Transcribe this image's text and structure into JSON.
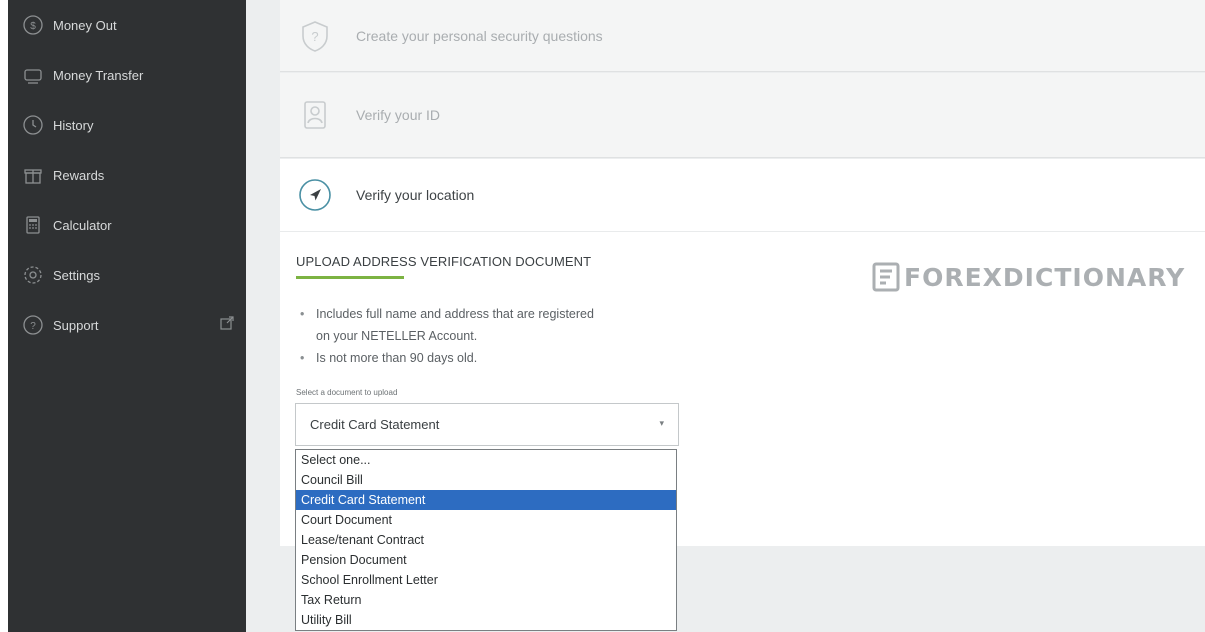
{
  "sidebar": {
    "items": [
      {
        "label": "Money Out",
        "icon": "money-out-icon"
      },
      {
        "label": "Money Transfer",
        "icon": "money-transfer-icon"
      },
      {
        "label": "History",
        "icon": "history-icon"
      },
      {
        "label": "Rewards",
        "icon": "rewards-icon"
      },
      {
        "label": "Calculator",
        "icon": "calculator-icon"
      },
      {
        "label": "Settings",
        "icon": "settings-icon"
      },
      {
        "label": "Support",
        "icon": "support-icon"
      }
    ]
  },
  "steps": [
    {
      "label": "Create your personal security questions",
      "icon": "shield-question-icon"
    },
    {
      "label": "Verify your ID",
      "icon": "id-card-icon"
    },
    {
      "label": "Verify your location",
      "icon": "location-arrow-icon"
    }
  ],
  "upload": {
    "title": "UPLOAD ADDRESS VERIFICATION DOCUMENT",
    "requirements": [
      "Includes full name and address that are registered",
      "on your NETELLER Account.",
      "Is not more than 90 days old."
    ],
    "select_label": "Select a document to upload",
    "selected_value": "Credit Card Statement",
    "options": [
      "Select one...",
      "Council Bill",
      "Credit Card Statement",
      "Court Document",
      "Lease/tenant Contract",
      "Pension Document",
      "School Enrollment Letter",
      "Tax Return",
      "Utility Bill"
    ],
    "highlighted_option": 2
  },
  "watermark": {
    "text": "FOREXDICTIONARY"
  },
  "colors": {
    "sidebar_bg": "#2f3133",
    "accent_green": "#7cb342",
    "selection_blue": "#2d6cc1",
    "icon_teal": "#4a90a4"
  }
}
